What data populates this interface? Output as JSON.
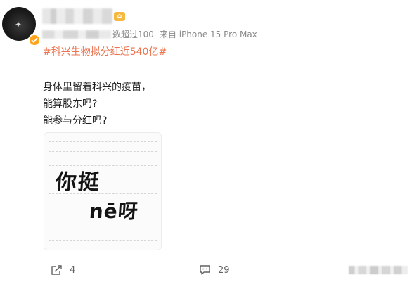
{
  "post": {
    "author": {
      "avatar_icon": "avatar-icon",
      "verified_badge_color": "#ffa31a"
    },
    "meta": {
      "read_count": "数超过100",
      "source": "来自 iPhone 15 Pro Max"
    },
    "topic": "#科兴生物拟分红近540亿#",
    "body_lines": [
      "身体里留着科兴的疫苗，",
      "能算股东吗?",
      "能参与分红吗?"
    ],
    "image": {
      "handwriting_line1": "你挺",
      "handwriting_line2": "nē呀"
    }
  },
  "actions": {
    "share_count": "4",
    "comment_count": "29"
  },
  "colors": {
    "topic_link": "#eb7350",
    "meta_text": "#8a8a8a",
    "body_text": "#1f1f1f"
  }
}
